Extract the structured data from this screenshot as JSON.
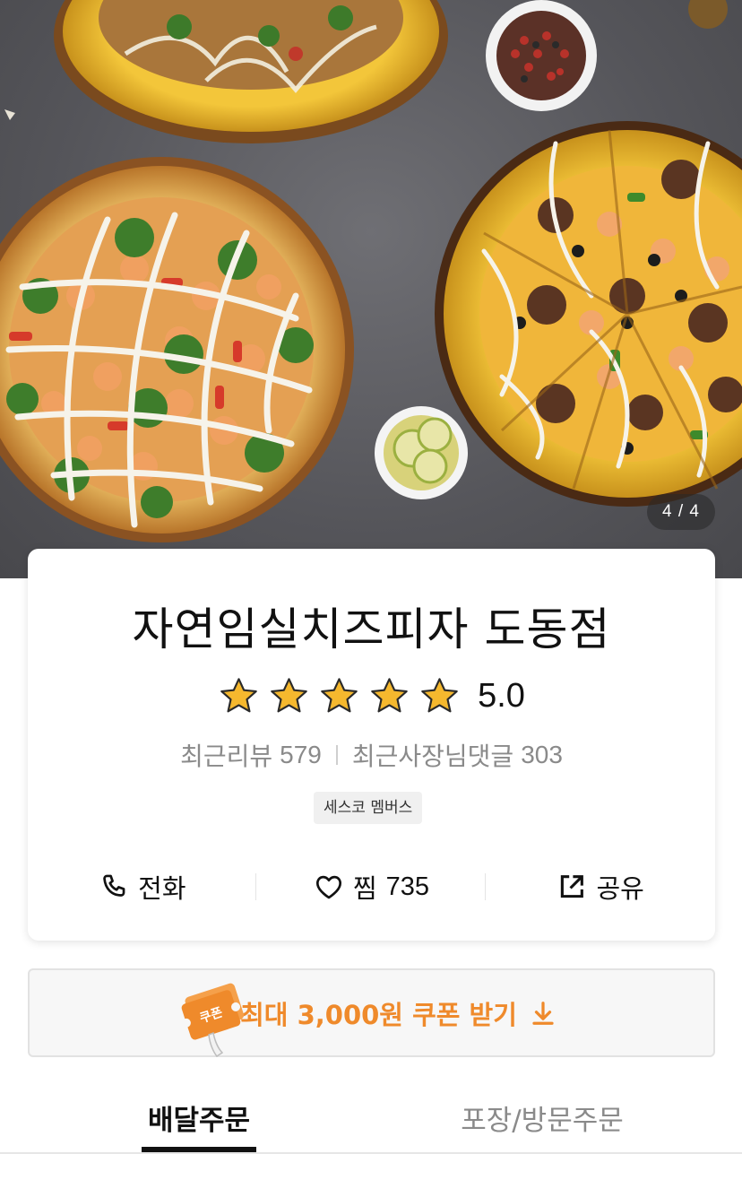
{
  "hero": {
    "counter": "4 / 4"
  },
  "store": {
    "name": "자연임실치즈피자 도동점",
    "rating": "5.0",
    "stars": 5,
    "recent_reviews_label": "최근리뷰",
    "recent_reviews_count": "579",
    "owner_replies_label": "최근사장님댓글",
    "owner_replies_count": "303",
    "badge": "세스코 멤버스"
  },
  "actions": {
    "call_label": "전화",
    "like_label": "찜",
    "like_count": "735",
    "share_label": "공유"
  },
  "coupon": {
    "icon_text": "쿠폰",
    "label": "최대 3,000원 쿠폰 받기"
  },
  "tabs": {
    "delivery": "배달주문",
    "pickup": "포장/방문주문"
  },
  "colors": {
    "accent": "#ef8a2b",
    "star": "#f5b82e",
    "muted": "#8a8a8a"
  }
}
